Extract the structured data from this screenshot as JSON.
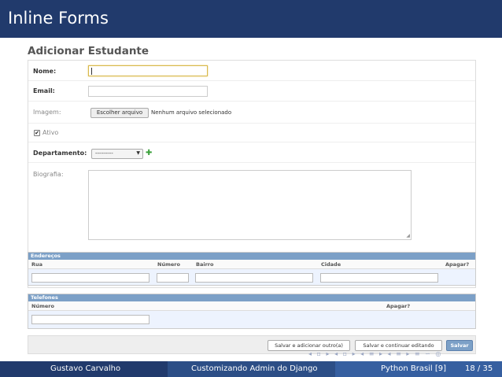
{
  "slide": {
    "title": "Inline Forms",
    "footer": {
      "author": "Gustavo Carvalho",
      "talk_title": "Customizando Admin do Django",
      "event": "Python Brasil [9]",
      "page": "18 / 35"
    }
  },
  "admin": {
    "page_title": "Adicionar Estudante",
    "fields": {
      "nome": {
        "label": "Nome:",
        "value": ""
      },
      "email": {
        "label": "Email:",
        "value": ""
      },
      "imagem": {
        "label": "Imagem:",
        "button": "Escolher arquivo",
        "status": "Nenhum arquivo selecionado"
      },
      "ativo": {
        "label": "Ativo",
        "checked": true
      },
      "departamento": {
        "label": "Departamento:",
        "selected": "---------"
      },
      "biografia": {
        "label": "Biografia:",
        "value": ""
      }
    },
    "enderecos": {
      "title": "Endereços",
      "columns": [
        "Rua",
        "Número",
        "Bairro",
        "Cidade",
        "Apagar?"
      ]
    },
    "telefones": {
      "title": "Telefones",
      "columns": [
        "Número",
        "Apagar?"
      ]
    },
    "buttons": {
      "save_add": "Salvar e adicionar outro(a)",
      "save_continue": "Salvar e continuar editando",
      "save": "Salvar"
    }
  },
  "icons": {
    "check": "check-icon",
    "add": "add-icon",
    "dropdown": "dropdown-arrow-icon",
    "nav": "beamer-nav-icons"
  },
  "colors": {
    "header_bg": "#213a6c",
    "inline_header": "#7ca0c7",
    "primary_button": "#7ca0c7",
    "add_icon": "#3aa03a"
  }
}
